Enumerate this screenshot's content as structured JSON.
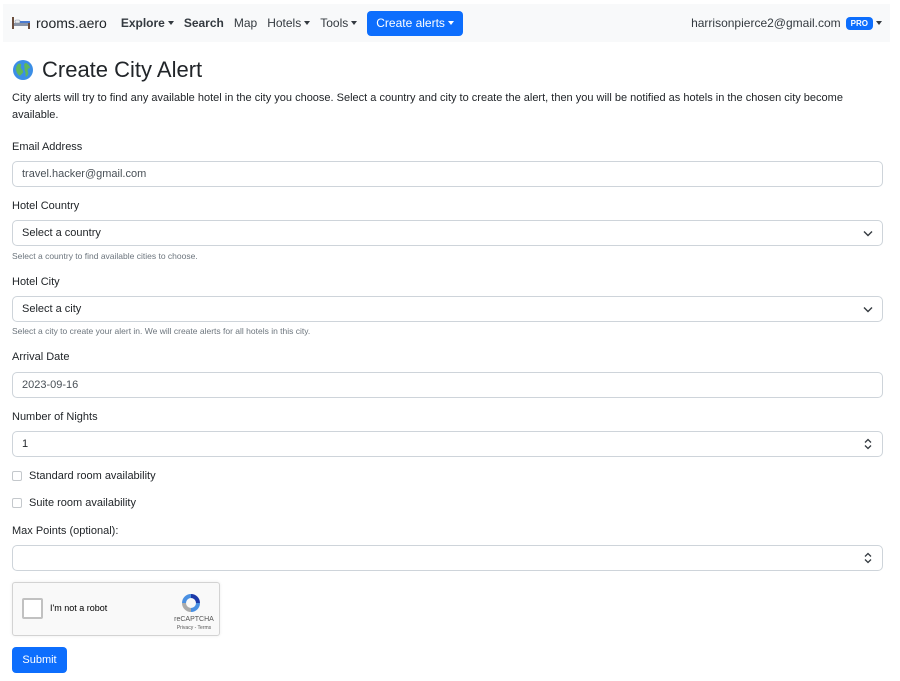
{
  "nav": {
    "brand": "rooms.aero",
    "explore": "Explore",
    "search": "Search",
    "map": "Map",
    "hotels": "Hotels",
    "tools": "Tools",
    "create_alerts": "Create alerts",
    "user_email": "harrisonpierce2@gmail.com",
    "badge": "PRO"
  },
  "page": {
    "title": "Create City Alert",
    "intro": "City alerts will try to find any available hotel in the city you choose. Select a country and city to create the alert, then you will be notified as hotels in the chosen city become available."
  },
  "form": {
    "email_label": "Email Address",
    "email_placeholder": "travel.hacker@gmail.com",
    "country_label": "Hotel Country",
    "country_value": "Select a country",
    "country_help": "Select a country to find available cities to choose.",
    "city_label": "Hotel City",
    "city_value": "Select a city",
    "city_help": "Select a city to create your alert in. We will create alerts for all hotels in this city.",
    "arrival_label": "Arrival Date",
    "arrival_value": "2023-09-16",
    "nights_label": "Number of Nights",
    "nights_value": "1",
    "standard_label": "Standard room availability",
    "suite_label": "Suite room availability",
    "max_points_label": "Max Points (optional):",
    "max_points_value": "",
    "submit": "Submit"
  },
  "captcha": {
    "label": "I'm not a robot",
    "brand": "reCAPTCHA",
    "terms": "Privacy - Terms"
  },
  "colors": {
    "primary": "#0d6efd",
    "navbar_bg": "#f8f9fa",
    "border": "#ced4da",
    "help_text": "#6c757d"
  },
  "icons": [
    "bed-icon",
    "globe-icon",
    "chevron-down-icon",
    "spinner-arrows-icon",
    "recaptcha-logo-icon"
  ]
}
